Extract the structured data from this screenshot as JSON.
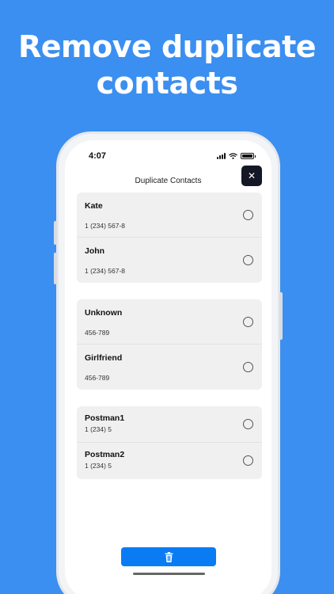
{
  "headline": {
    "line1": "Remove duplicate",
    "line2": "contacts"
  },
  "status_bar": {
    "time": "4:07",
    "icons": [
      "signal-icon",
      "wifi-icon",
      "battery-icon"
    ]
  },
  "nav": {
    "title": "Duplicate Contacts",
    "close_icon": "close-icon",
    "close_label": "✕"
  },
  "groups": [
    {
      "contacts": [
        {
          "name": "Kate",
          "phone": "1 (234) 567-8",
          "selected": false
        },
        {
          "name": "John",
          "phone": "1 (234) 567-8",
          "selected": false
        }
      ]
    },
    {
      "contacts": [
        {
          "name": "Unknown",
          "phone": "456-789",
          "selected": false
        },
        {
          "name": "Girlfriend",
          "phone": "456-789",
          "selected": false
        }
      ]
    },
    {
      "contacts": [
        {
          "name": "Postman1",
          "phone": "1 (234) 5",
          "selected": false
        },
        {
          "name": "Postman2",
          "phone": "1 (234) 5",
          "selected": false
        }
      ]
    }
  ],
  "delete_button": {
    "icon": "trash-icon"
  },
  "colors": {
    "background": "#3b8ff0",
    "accent": "#0a7cf3",
    "close_button": "#141826"
  }
}
